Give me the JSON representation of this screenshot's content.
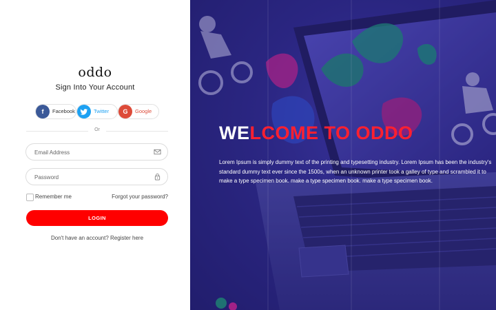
{
  "login": {
    "brand": "oddo",
    "subtitle": "Sign Into Your Account",
    "social": {
      "facebook_label": "Facebook",
      "twitter_label": "Twitter",
      "google_label": "Google"
    },
    "or_text": "Or",
    "email_placeholder": "Email Address",
    "password_placeholder": "Password",
    "remember_label": "Remember me",
    "forgot_label": "Forgot your password?",
    "login_button": "LOGIN",
    "register_text": "Don't have an account? Register here"
  },
  "hero": {
    "title_white_1": "WE",
    "title_red": "LCOME TO ODDO",
    "body": "Lorem Ipsum is simply dummy text of the printing and typesetting industry. Lorem Ipsum has been the industry's standard dummy text ever since the 1500s, when an unknown printer took a galley of type and scrambled it to make a type specimen book. make a type specimen book. make a type specimen book."
  },
  "icons": {
    "facebook": "facebook-icon",
    "twitter": "twitter-icon",
    "google": "google-icon",
    "email": "envelope-icon",
    "password": "lock-icon"
  },
  "colors": {
    "accent": "#ff0000",
    "facebook": "#3b5998",
    "twitter": "#1da1f2",
    "google": "#dd4b39",
    "hero_bg": "#2b2783"
  }
}
